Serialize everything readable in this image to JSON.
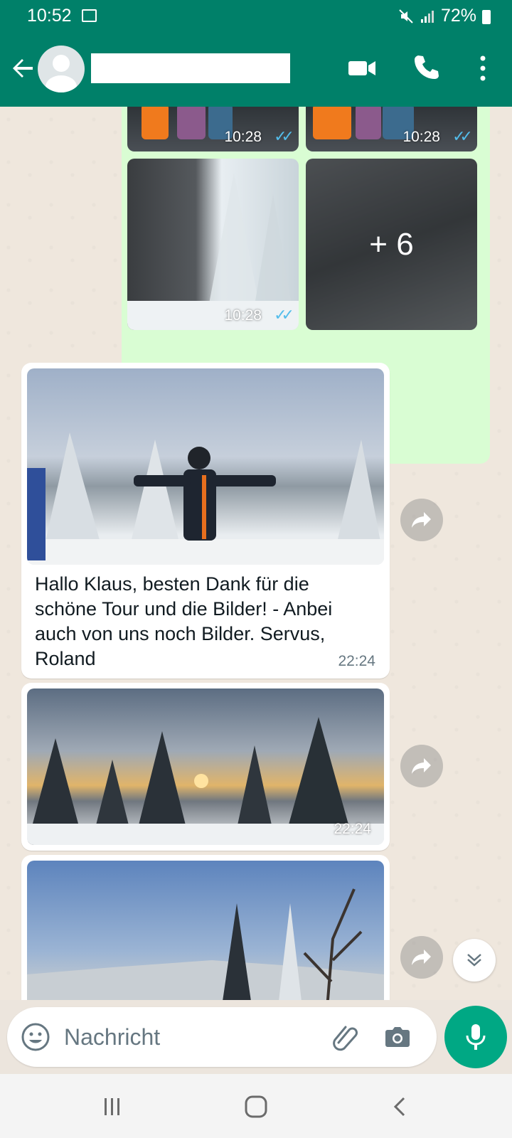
{
  "status_bar": {
    "time": "10:52",
    "battery": "72%",
    "icons": [
      "image-icon",
      "mute-icon",
      "signal-icon",
      "battery-icon"
    ]
  },
  "header": {
    "contact_name": "",
    "icons": [
      "back-arrow-icon",
      "avatar-icon",
      "video-call-icon",
      "phone-icon",
      "more-vert-icon"
    ]
  },
  "outgoing_images": {
    "tiles": [
      {
        "time": "10:28"
      },
      {
        "time": "10:28"
      },
      {
        "time": "10:28"
      },
      {
        "more": "+ 6"
      }
    ],
    "tick_color": "#53bdeb",
    "bubble_color": "#d9fdd3"
  },
  "incoming": [
    {
      "caption": "Hallo Klaus, besten Dank für die schöne Tour und die Bilder! - Anbei auch von uns noch Bilder. Servus, Roland",
      "time": "22:24"
    },
    {
      "time": "22:24"
    },
    {}
  ],
  "composer": {
    "placeholder": "Nachricht",
    "value": ""
  },
  "colors": {
    "header": "#008069",
    "accent": "#00a884",
    "chat_bg": "#efe7dd"
  }
}
